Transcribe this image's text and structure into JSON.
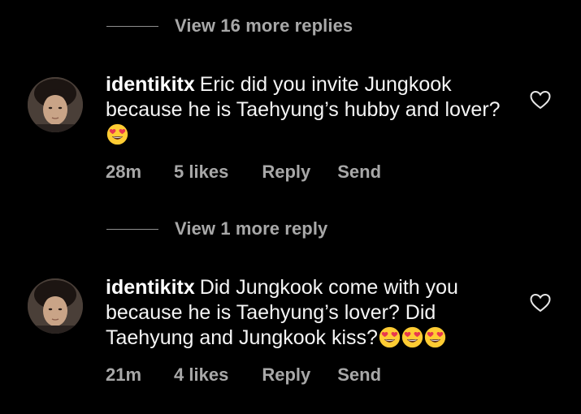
{
  "thread": {
    "view_more_top": "View 16 more replies",
    "view_more_mid": "View 1 more reply"
  },
  "comments": [
    {
      "username": "identikitx",
      "text": "Eric did you invite Jungkook because he is Taehyung’s hubby and lover?",
      "emoji": [
        "heart-eyes"
      ],
      "time": "28m",
      "likes": "5 likes",
      "reply_label": "Reply",
      "send_label": "Send"
    },
    {
      "username": "identikitx",
      "text": "Did Jungkook come with you because he is Taehyung’s lover? Did Taehyung and Jungkook kiss?",
      "emoji": [
        "heart-eyes",
        "heart-eyes",
        "heart-eyes"
      ],
      "time": "21m",
      "likes": "4 likes",
      "reply_label": "Reply",
      "send_label": "Send"
    }
  ],
  "icons": {
    "like": "heart-outline-icon",
    "emoji": "smiling-face-with-heart-eyes"
  },
  "colors": {
    "background": "#000000",
    "text": "#ffffff",
    "muted": "#a8a8a8",
    "emoji_face": "#ffcc33",
    "emoji_heart": "#e8384f"
  }
}
